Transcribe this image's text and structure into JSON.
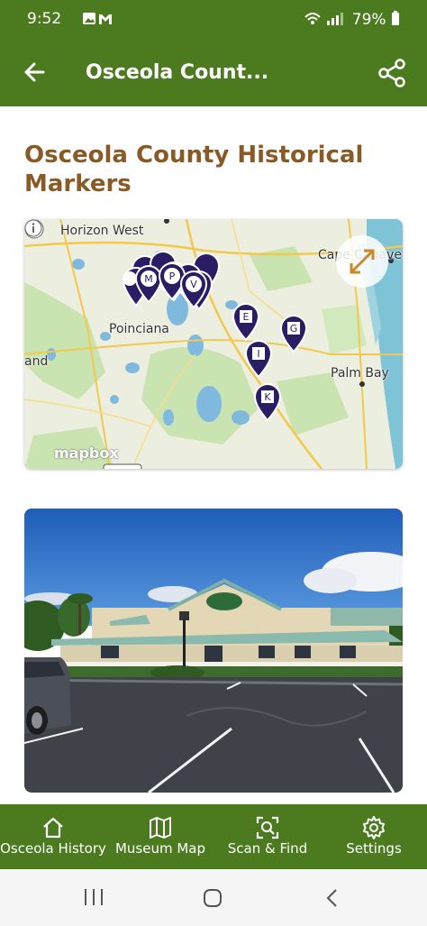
{
  "status_bar": {
    "time": "9:52",
    "notif_icons": [
      "image-icon",
      "gmail-icon"
    ],
    "battery": "79%"
  },
  "app_bar": {
    "title": "Osceola Count...",
    "back_icon": "arrow-left-icon",
    "share_icon": "share-icon"
  },
  "page": {
    "title": "Osceola County Historical Markers"
  },
  "map": {
    "labels": {
      "horizon_west": "Horizon West",
      "cape_canaveral": "Cape Canave",
      "poinciana": "Poinciana",
      "palm_bay": "Palm Bay",
      "land": "and"
    },
    "markers": [
      "M",
      "P",
      "V",
      "E",
      "G",
      "I",
      "K"
    ],
    "attribution": "mapbox",
    "expand_icon": "expand-arrows-icon"
  },
  "bottom_nav": {
    "items": [
      {
        "label": "Osceola History",
        "icon": "home-icon",
        "active": true
      },
      {
        "label": "Museum Map",
        "icon": "map-icon",
        "active": false
      },
      {
        "label": "Scan & Find",
        "icon": "scan-icon",
        "active": false
      },
      {
        "label": "Settings",
        "icon": "gear-icon",
        "active": false
      }
    ]
  },
  "colors": {
    "primary": "#4b7a1f",
    "title": "#8a5a26",
    "marker": "#2a1d63"
  }
}
